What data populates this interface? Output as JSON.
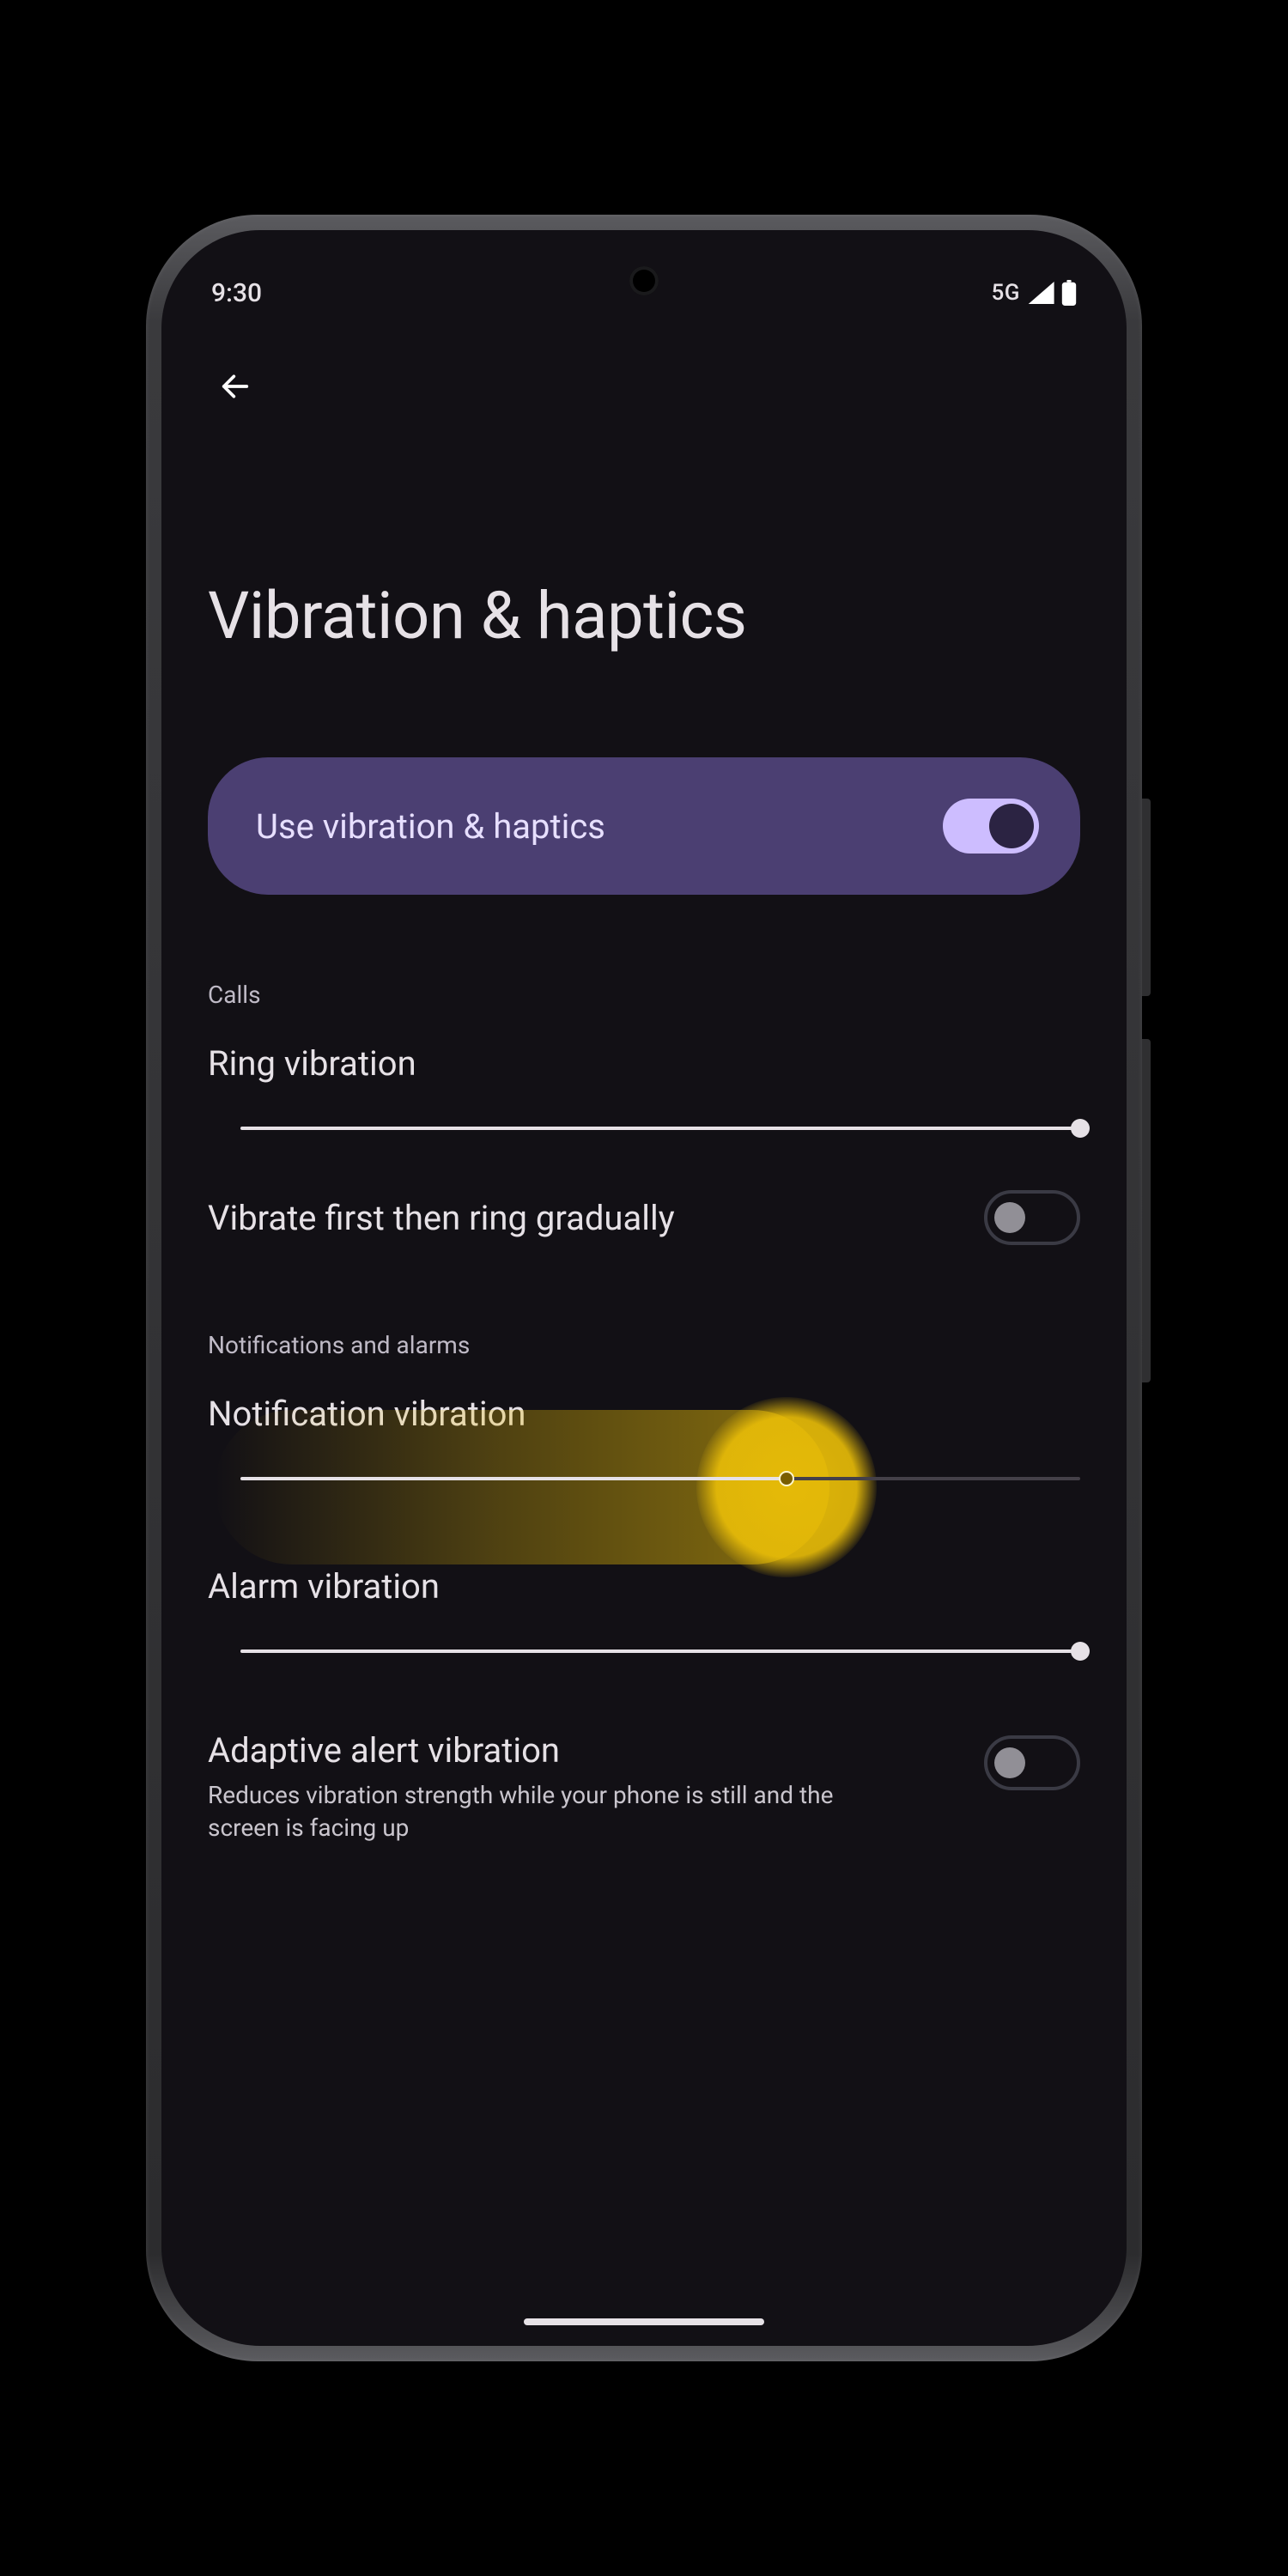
{
  "status": {
    "time": "9:30",
    "network_label": "5G"
  },
  "nav": {
    "back_icon": "back-arrow"
  },
  "page": {
    "title": "Vibration & haptics"
  },
  "master": {
    "label": "Use vibration & haptics",
    "enabled": true
  },
  "sections": {
    "calls": {
      "label": "Calls",
      "ring_vibration": {
        "title": "Ring vibration",
        "value_pct": 100
      },
      "vibrate_first": {
        "title": "Vibrate first then ring gradually",
        "enabled": false
      }
    },
    "notifications_alarms": {
      "label": "Notifications and alarms",
      "notification_vibration": {
        "title": "Notification vibration",
        "value_pct": 65,
        "highlighted": true
      },
      "alarm_vibration": {
        "title": "Alarm vibration",
        "value_pct": 100
      },
      "adaptive_alert": {
        "title": "Adaptive alert vibration",
        "subtitle": "Reduces vibration strength while your phone is still and the screen is facing up",
        "enabled": false
      }
    }
  },
  "colors": {
    "screen_bg": "#121015",
    "purple_pill": "#4b3f72",
    "purple_light": "#cdbdff",
    "highlight": "#e6b900"
  }
}
